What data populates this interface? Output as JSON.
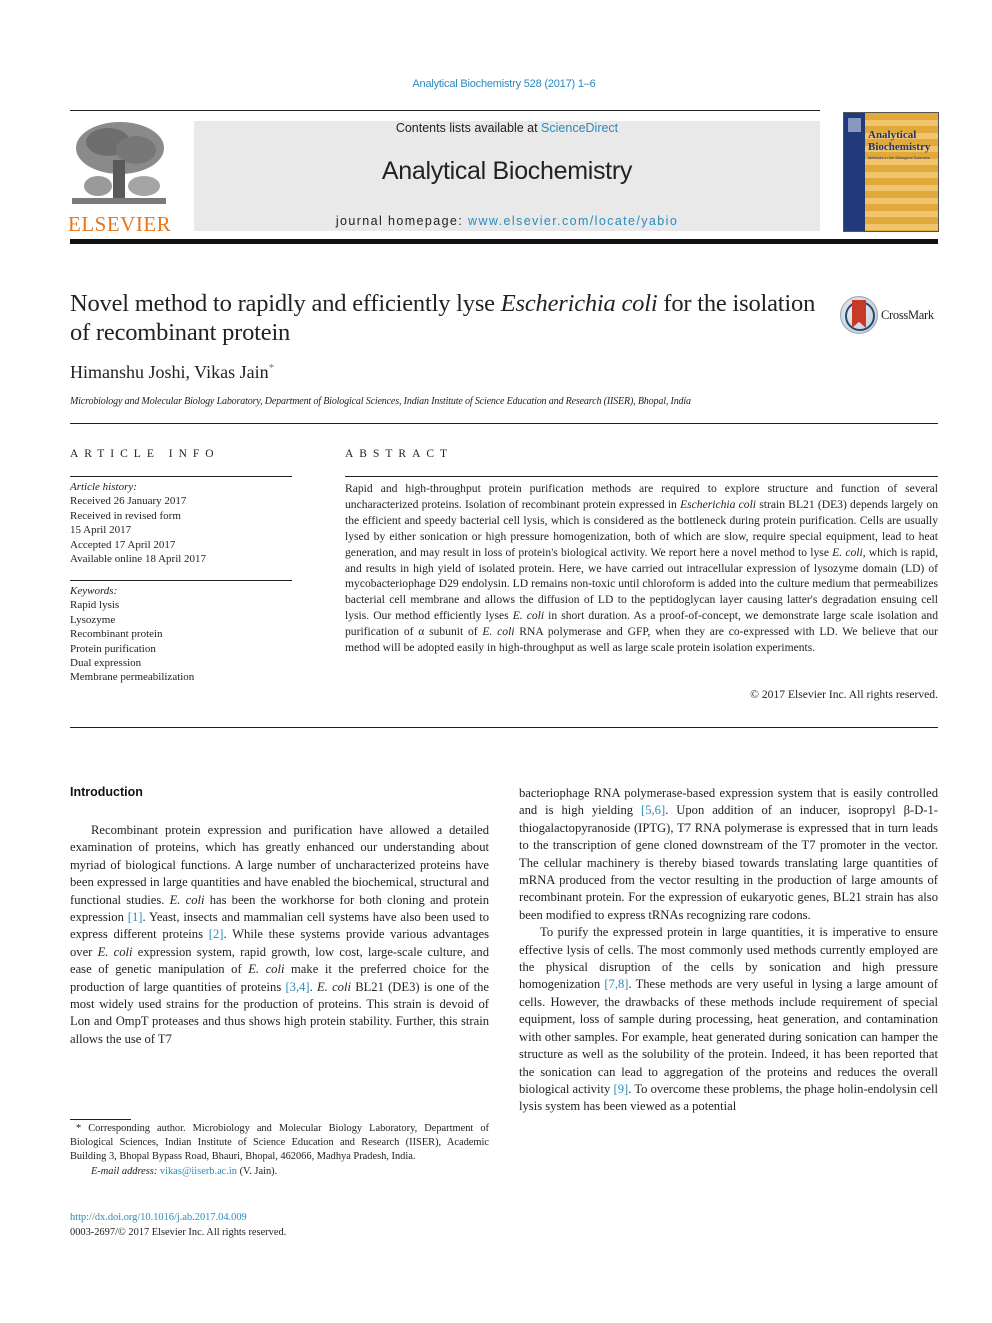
{
  "header": {
    "journal_ref": "Analytical Biochemistry 528 (2017) 1–6",
    "publisher_logo_text": "ELSEVIER",
    "contents_prefix": "Contents lists available at ",
    "contents_link": "ScienceDirect",
    "journal_title": "Analytical Biochemistry",
    "homepage_prefix": "journal homepage: ",
    "homepage_link": "www.elsevier.com/locate/yabio",
    "cover_title_line1": "Analytical",
    "cover_title_line2": "Biochemistry",
    "cover_subtitle": "Methods in the Biological Sciences"
  },
  "colors": {
    "link": "#2a8bbd",
    "elsevier_orange": "#e8751a",
    "banner_bg": "#e9e9e9",
    "cover_gold": "#e1a93a",
    "cover_blue": "#213a7c",
    "crossmark_red": "#c63a26"
  },
  "article": {
    "title_part1": "Novel method to rapidly and efficiently lyse ",
    "title_italic": "Escherichia coli",
    "title_part2": " for the isolation of recombinant protein",
    "crossmark_label": "CrossMark",
    "authors": "Himanshu Joshi, Vikas Jain",
    "author_mark": "*",
    "affiliation": "Microbiology and Molecular Biology Laboratory, Department of Biological Sciences, Indian Institute of Science Education and Research (IISER), Bhopal, India"
  },
  "article_info": {
    "heading": "ARTICLE INFO",
    "history_label": "Article history:",
    "history": [
      "Received 26 January 2017",
      "Received in revised form",
      "15 April 2017",
      "Accepted 17 April 2017",
      "Available online 18 April 2017"
    ],
    "keywords_label": "Keywords:",
    "keywords": [
      "Rapid lysis",
      "Lysozyme",
      "Recombinant protein",
      "Protein purification",
      "Dual expression",
      "Membrane permeabilization"
    ]
  },
  "abstract": {
    "heading": "ABSTRACT",
    "s1": "Rapid and high-throughput protein purification methods are required to explore structure and function of several uncharacterized proteins. Isolation of recombinant protein expressed in ",
    "i1": "Escherichia coli",
    "s2": " strain BL21 (DE3) depends largely on the efficient and speedy bacterial cell lysis, which is considered as the bottleneck during protein purification. Cells are usually lysed by either sonication or high pressure homogenization, both of which are slow, require special equipment, lead to heat generation, and may result in loss of protein's biological activity. We report here a novel method to lyse ",
    "i2": "E. coli",
    "s3": ", which is rapid, and results in high yield of isolated protein. Here, we have carried out intracellular expression of lysozyme domain (LD) of mycobacteriophage D29 endolysin. LD remains non-toxic until chloroform is added into the culture medium that permeabilizes bacterial cell membrane and allows the diffusion of LD to the peptidoglycan layer causing latter's degradation ensuing cell lysis. Our method efficiently lyses ",
    "i3": "E. coli",
    "s4": " in short duration. As a proof-of-concept, we demonstrate large scale isolation and purification of α subunit of ",
    "i4": "E. coli",
    "s5": " RNA polymerase and GFP, when they are co-expressed with LD. We believe that our method will be adopted easily in high-throughput as well as large scale protein isolation experiments.",
    "copyright": "© 2017 Elsevier Inc. All rights reserved."
  },
  "introduction": {
    "heading": "Introduction",
    "p1_a": "Recombinant protein expression and purification have allowed a detailed examination of proteins, which has greatly enhanced our understanding about myriad of biological functions. A large number of uncharacterized proteins have been expressed in large quantities and have enabled the biochemical, structural and functional studies. ",
    "p1_i1": "E. coli",
    "p1_b": " has been the workhorse for both cloning and protein expression ",
    "p1_ref1": "[1]",
    "p1_c": ". Yeast, insects and mammalian cell systems have also been used to express different proteins ",
    "p1_ref2": "[2]",
    "p1_d": ". While these systems provide various advantages over ",
    "p1_i2": "E. coli",
    "p1_e": " expression system, rapid growth, low cost, large-scale culture, and ease of genetic manipulation of ",
    "p1_i3": "E. coli",
    "p1_f": " make it the preferred choice for the production of large quantities of proteins ",
    "p1_ref3": "[3,4]",
    "p1_g": ". ",
    "p1_i4": "E. coli",
    "p1_h": " BL21 (DE3) is one of the most widely used strains for the production of proteins. This strain is devoid of Lon and OmpT proteases and thus shows high protein stability. Further, this strain allows the use of T7 bacteriophage RNA polymerase-based expression system that is easily controlled and is high yielding ",
    "p1_ref4": "[5,6]",
    "p1_j": ". Upon addition of an inducer, isopropyl β-D-1-thiogalactopyranoside (IPTG), T7 RNA polymerase is expressed that in turn leads to the transcription of gene cloned downstream of the T7 promoter in the vector. The cellular machinery is thereby biased towards translating large quantities of mRNA produced from the vector resulting in the production of large amounts of recombinant protein. For the expression of eukaryotic genes, BL21 strain has also been modified to express tRNAs recognizing rare codons.",
    "left_col_end": "protein stability. Further, this strain allows the use of T7",
    "right_col_start": "bacteriophage RNA polymerase-based expression system that is easily controlled and is high yielding ",
    "p2_a": "To purify the expressed protein in large quantities, it is imperative to ensure effective lysis of cells. The most commonly used methods currently employed are the physical disruption of the cells by sonication and high pressure homogenization ",
    "p2_ref1": "[7,8]",
    "p2_b": ". These methods are very useful in lysing a large amount of cells. However, the drawbacks of these methods include requirement of special equipment, loss of sample during processing, heat generation, and contamination with other samples. For example, heat generated during sonication can hamper the structure as well as the solubility of the protein. Indeed, it has been reported that the sonication can lead to aggregation of the proteins and reduces the overall biological activity ",
    "p2_ref2": "[9]",
    "p2_c": ". To overcome these problems, the phage holin-endolysin cell lysis system has been viewed as a potential"
  },
  "footnote": {
    "corresponding": "* Corresponding author. Microbiology and Molecular Biology Laboratory, Department of Biological Sciences, Indian Institute of Science Education and Research (IISER), Academic Building 3, Bhopal Bypass Road, Bhauri, Bhopal, 462066, Madhya Pradesh, India.",
    "email_label": "E-mail address: ",
    "email": "vikas@iiserb.ac.in",
    "email_suffix": " (V. Jain).",
    "doi": "http://dx.doi.org/10.1016/j.ab.2017.04.009",
    "issn": "0003-2697/© 2017 Elsevier Inc. All rights reserved."
  }
}
